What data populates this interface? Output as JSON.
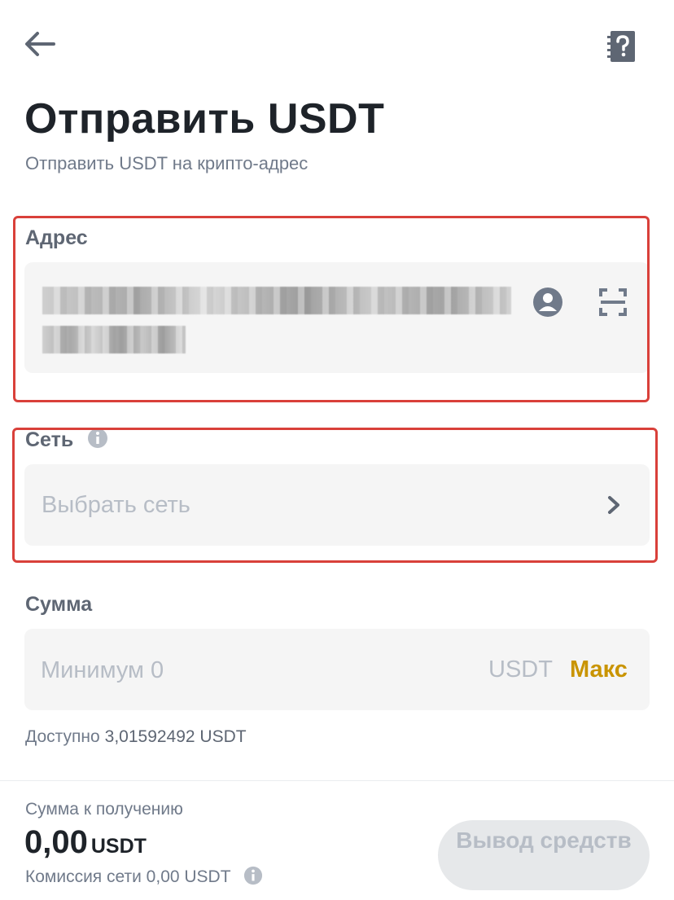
{
  "header": {
    "back_icon": "arrow-left-icon",
    "help_icon": "help-book-icon"
  },
  "page": {
    "title": "Отправить USDT",
    "subtitle": "Отправить USDT на крипто-адрес"
  },
  "address": {
    "label": "Адрес",
    "value": "(redacted — pixelated in screenshot)",
    "contact_icon": "address-book-icon",
    "scan_icon": "qr-scan-icon"
  },
  "network": {
    "label": "Сеть",
    "info_icon": "info-icon",
    "placeholder": "Выбрать сеть",
    "chevron_icon": "chevron-right-icon"
  },
  "amount": {
    "label": "Сумма",
    "placeholder": "Минимум 0",
    "value": "",
    "unit": "USDT",
    "max_label": "Макс"
  },
  "available": {
    "label": "Доступно",
    "value": "3,01592492 USDT"
  },
  "footer": {
    "receive_label": "Сумма к получению",
    "receive_amount": "0,00",
    "receive_unit": "USDT",
    "fee_text": "Комиссия сети 0,00 USDT",
    "withdraw_label": "Вывод средств",
    "withdraw_enabled": false
  },
  "colors": {
    "accent": "#c99400",
    "highlight_border": "#d9403a",
    "field_bg": "#f5f5f5",
    "text_primary": "#1e2329",
    "text_secondary": "#707a8a",
    "placeholder": "#b7bdc6"
  }
}
